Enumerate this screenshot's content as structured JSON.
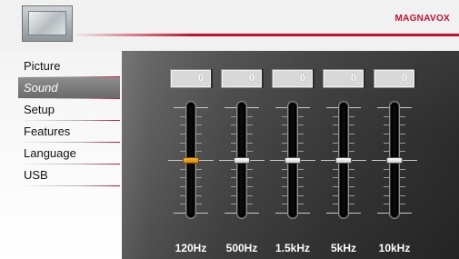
{
  "header": {
    "brand": "MAGNAVOX",
    "accent_color": "#c8102e",
    "icon": "tv-monitor-icon"
  },
  "sidebar": {
    "items": [
      {
        "label": "Picture",
        "selected": false
      },
      {
        "label": "Sound",
        "selected": true
      },
      {
        "label": "Setup",
        "selected": false
      },
      {
        "label": "Features",
        "selected": false
      },
      {
        "label": "Language",
        "selected": false
      },
      {
        "label": "USB",
        "selected": false
      }
    ]
  },
  "equalizer": {
    "bands": [
      {
        "frequency": "120Hz",
        "value": "0",
        "active": true
      },
      {
        "frequency": "500Hz",
        "value": "0",
        "active": false
      },
      {
        "frequency": "1.5kHz",
        "value": "0",
        "active": false
      },
      {
        "frequency": "5kHz",
        "value": "0",
        "active": false
      },
      {
        "frequency": "10kHz",
        "value": "0",
        "active": false
      }
    ],
    "active_thumb_color": "#e39a1a"
  }
}
